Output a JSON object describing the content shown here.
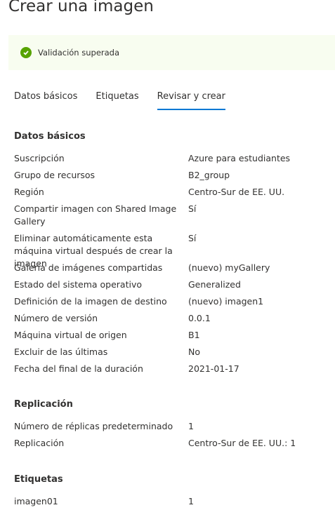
{
  "title": "Crear una imagen",
  "banner": {
    "text": "Validación superada",
    "color": "#57a300"
  },
  "tabs": [
    "Datos básicos",
    "Etiquetas",
    "Revisar y crear"
  ],
  "sections": [
    {
      "heading": "Datos básicos",
      "rows": [
        [
          "Suscripción",
          "Azure para estudiantes"
        ],
        [
          "Grupo de recursos",
          "B2_group"
        ],
        [
          "Región",
          "Centro-Sur de EE. UU."
        ],
        [
          "Compartir imagen con Shared Image Gallery",
          "Sí"
        ],
        [
          "Eliminar automáticamente esta máquina virtual después de crear la imagen",
          "Sí"
        ],
        [
          "Galería de imágenes compartidas",
          "(nuevo) myGallery"
        ],
        [
          "Estado del sistema operativo",
          "Generalized"
        ],
        [
          "Definición de la imagen de destino",
          "(nuevo) imagen1"
        ],
        [
          "Número de versión",
          "0.0.1"
        ],
        [
          "Máquina virtual de origen",
          "B1"
        ],
        [
          "Excluir de las últimas",
          "No"
        ],
        [
          "Fecha del final de la duración",
          "2021-01-17"
        ]
      ]
    },
    {
      "heading": "Replicación",
      "rows": [
        [
          "Número de réplicas predeterminado",
          "1"
        ],
        [
          "Replicación",
          "Centro-Sur de EE. UU.: 1"
        ]
      ]
    },
    {
      "heading": "Etiquetas",
      "rows": [
        [
          "imagen01",
          "1"
        ]
      ]
    }
  ]
}
